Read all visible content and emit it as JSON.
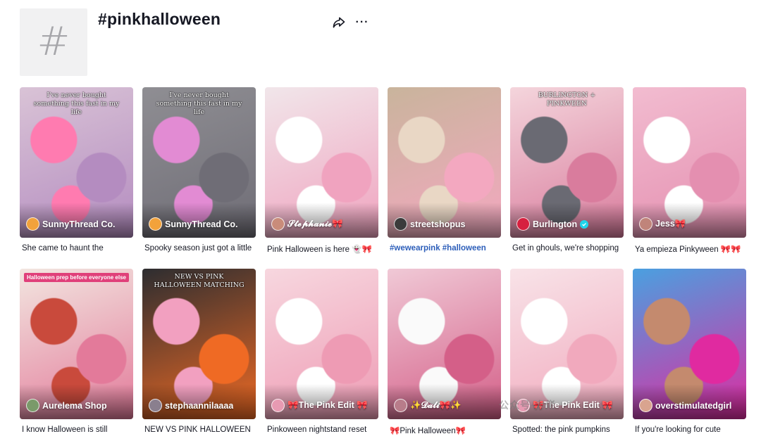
{
  "header": {
    "hash_symbol": "#",
    "title": "#pinkhalloween",
    "share_icon": "share-arrow-icon",
    "more_label": "···"
  },
  "colors": {
    "text": "#161823",
    "link": "#2b5db9",
    "hash_bg": "#f1f1f2",
    "verified": "#20d5ec"
  },
  "videos": [
    {
      "author": "SunnyThread Co.",
      "caption": "She came to haunt the",
      "verified": false,
      "overlay": "I've never bought something this fast in my life",
      "scene": [
        "#d9c3d6",
        "#b48cc0",
        "#ff7bb0"
      ],
      "avatar": "#f2a23b"
    },
    {
      "author": "SunnyThread Co.",
      "caption": "Spooky season just got a little",
      "verified": false,
      "overlay": "I've never bought something this fast in my life",
      "scene": [
        "#8f8e93",
        "#6f6d76",
        "#e28bd3"
      ],
      "avatar": "#f2a23b"
    },
    {
      "author": "𝓢𝓽𝓮𝓹𝓱𝓪𝓷𝓲𝓮🎀",
      "caption": "Pink Halloween is here 👻🎀",
      "verified": false,
      "overlay": "",
      "scene": [
        "#f1e6ea",
        "#f0a3bf",
        "#ffffff"
      ],
      "avatar": "#c98c7a"
    },
    {
      "author": "streetshopus",
      "caption": "#wewearpink #halloween",
      "verified": false,
      "overlay": "",
      "scene": [
        "#c9b49c",
        "#f3a8c0",
        "#e9d7c5"
      ],
      "avatar": "#3b3b3b"
    },
    {
      "author": "Burlington",
      "caption": "Get in ghouls, we're shopping",
      "verified": true,
      "overlay": "BURLINGTON + PINKWEEN",
      "scene": [
        "#f4d5dc",
        "#d97c9d",
        "#6a6a73"
      ],
      "avatar": "#d6203f"
    },
    {
      "author": "Jess🎀",
      "caption": "Ya empieza Pinkyween 🎀🎀",
      "verified": false,
      "overlay": "",
      "scene": [
        "#f2bcd0",
        "#e48fb0",
        "#ffffff"
      ],
      "avatar": "#c0847a"
    },
    {
      "author": "Aurelema Shop",
      "caption": "I know Halloween is still",
      "verified": false,
      "overlay": "Halloween prep before everyone else",
      "scene": [
        "#f2e6e0",
        "#e37a9a",
        "#c94a3c"
      ],
      "avatar": "#7a9a6a"
    },
    {
      "author": "stephaannilaaaa",
      "caption": "NEW VS PINK HALLOWEEN",
      "verified": false,
      "overlay": "NEW VS PINK HALLOWEEN MATCHING",
      "scene": [
        "#2d2d30",
        "#ef6a24",
        "#f2a0c0"
      ],
      "avatar": "#8a7f8e"
    },
    {
      "author": "🎀The Pink Edit 🎀",
      "caption": "Pinkoween nightstand reset",
      "verified": false,
      "overlay": "",
      "scene": [
        "#f7d7df",
        "#ee9bb4",
        "#ffffff"
      ],
      "avatar": "#e79ab2"
    },
    {
      "author": "✨𝓓𝓪𝓵𝓲🎀✨",
      "caption": "🎀Pink Halloween🎀",
      "verified": false,
      "overlay": "",
      "scene": [
        "#f0c9d6",
        "#d45f88",
        "#fafafa"
      ],
      "avatar": "#b87c8a"
    },
    {
      "author": "🎀The Pink Edit 🎀",
      "caption": "Spotted: the pink pumpkins",
      "verified": false,
      "overlay": "",
      "scene": [
        "#f8e3e8",
        "#f1a9bd",
        "#ffffff"
      ],
      "avatar": "#e79ab2"
    },
    {
      "author": "overstimulatedgirl",
      "caption": "If you're looking for cute",
      "verified": false,
      "overlay": "",
      "scene": [
        "#4aa0e0",
        "#e02aa0",
        "#c48a6e"
      ],
      "avatar": "#d9a48f"
    }
  ],
  "watermark": "公众号·大佬"
}
